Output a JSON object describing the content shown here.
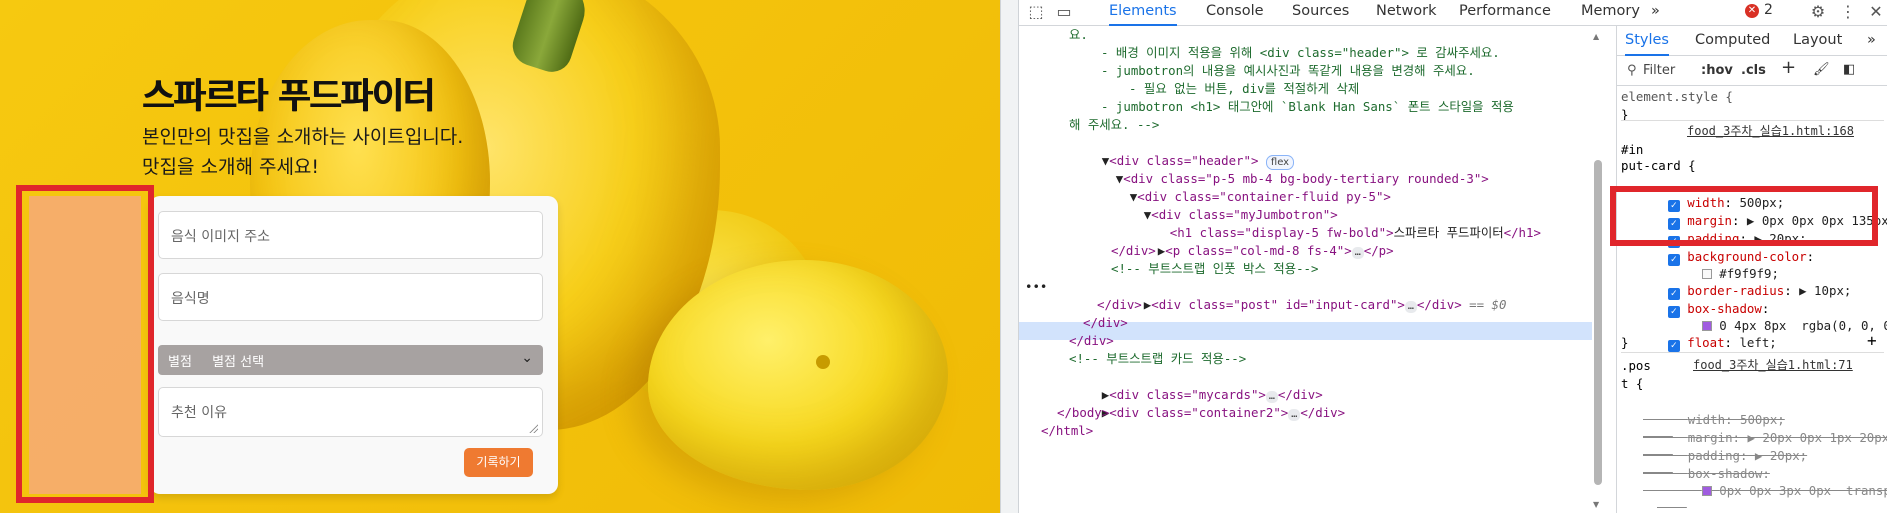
{
  "page": {
    "title": "스파르타 푸드파이터",
    "subtitle_line1": "본인만의 맛집을 소개하는 사이트입니다.",
    "subtitle_line2": "맛집을 소개해 주세요!",
    "card": {
      "image_placeholder": "음식 이미지 주소",
      "name_placeholder": "음식명",
      "rating_label": "별점",
      "rating_selected": "별점 선택",
      "reason_placeholder": "추천 이유",
      "save_label": "기록하기"
    }
  },
  "devtools": {
    "tabs": [
      "Elements",
      "Console",
      "Sources",
      "Network",
      "Performance",
      "Memory"
    ],
    "active_tab": "Elements",
    "more_tabs": "»",
    "error_count": "2",
    "dom": {
      "l0": "요.",
      "l1": "- 배경 이미지 적용을 위해 <div class=\"header\"> 로 감싸주세요.",
      "l2": "- jumbotron의 내용을 예시사진과 똑같게 내용을 변경해 주세요.",
      "l3": "- 필요 없는 버튼, div를 적절하게 삭제",
      "l4": "- jumbotron <h1> 태그안에 `Blank Han Sans` 폰트 스타일을 적용",
      "l5": "해 주세요. -->",
      "l6_open": "<div class=\"header\">",
      "l6_badge": "flex",
      "l7": "<div class=\"p-5 mb-4 bg-body-tertiary rounded-3\">",
      "l8": "<div class=\"container-fluid py-5\">",
      "l9": "<div class=\"myJumbotron\">",
      "l10_tag_open": "<h1 class=\"display-5 fw-bold\">",
      "l10_text": "스파르타 푸드파이터",
      "l10_tag_close": "</h1>",
      "l11": "<p class=\"col-md-8 fs-4\">",
      "l11_close": "</p>",
      "l12": "</div>",
      "l13": "<!-- 부트스트랩 인풋 박스 적용-->",
      "l14_tag": "<div class=\"post\" id=\"input-card\">",
      "l14_close": "</div>",
      "l14_eq": "== $0",
      "l15": "</div>",
      "l16": "</div>",
      "l17": "</div>",
      "l18": "<!-- 부트스트랩 카드 적용-->",
      "l19": "<div class=\"mycards\">",
      "l19_close": "</div>",
      "l20": "<div class=\"container2\">",
      "l20_close": "</div>",
      "l21": "</body>",
      "l22": "</html>",
      "ellipsis": "…",
      "more_dots": "•••"
    },
    "styles": {
      "tabs": [
        "Styles",
        "Computed",
        "Layout"
      ],
      "active_tab": "Styles",
      "more": "»",
      "filter_placeholder": "Filter",
      "hov": ":hov",
      "cls": ".cls",
      "add": "+",
      "element_style": "element.style {",
      "close_brace": "}",
      "rule1_source": "food_3주차_실습1.html:168",
      "rule1_selector_a": "#in",
      "rule1_selector_b": "put-card {",
      "rule1": [
        {
          "prop": "width",
          "value": "500px;"
        },
        {
          "prop": "margin",
          "value": "▶ 0px 0px 0px 135px;"
        },
        {
          "prop": "padding",
          "value": "▶ 20px;"
        },
        {
          "prop": "background-color",
          "value": ""
        },
        {
          "prop": "",
          "value": "#f9f9f9;"
        },
        {
          "prop": "border-radius",
          "value": "▶ 10px;"
        },
        {
          "prop": "box-shadow",
          "value": ""
        },
        {
          "prop": "",
          "value": "0 4px 8px  rgba(0, 0, 0"
        },
        {
          "prop": "float",
          "value": "left;"
        }
      ],
      "rule2_source": "food_3주차_실습1.html:71",
      "rule2_selector_a": ".pos",
      "rule2_selector_b": "t {",
      "rule2": [
        {
          "prop": "width",
          "value": "500px;"
        },
        {
          "prop": "margin",
          "value": "▶ 20px 0px 1px 20px;"
        },
        {
          "prop": "padding",
          "value": "▶ 20px;"
        },
        {
          "prop": "box-shadow",
          "value": ""
        },
        {
          "prop": "",
          "value": "0px 0px 3px 0px  transp"
        }
      ]
    }
  },
  "colors": {
    "accent_red": "#e0262b",
    "devtools_blue": "#1a73e8",
    "save_button": "#ef7a31",
    "card_bg": "#f9f9f9"
  }
}
